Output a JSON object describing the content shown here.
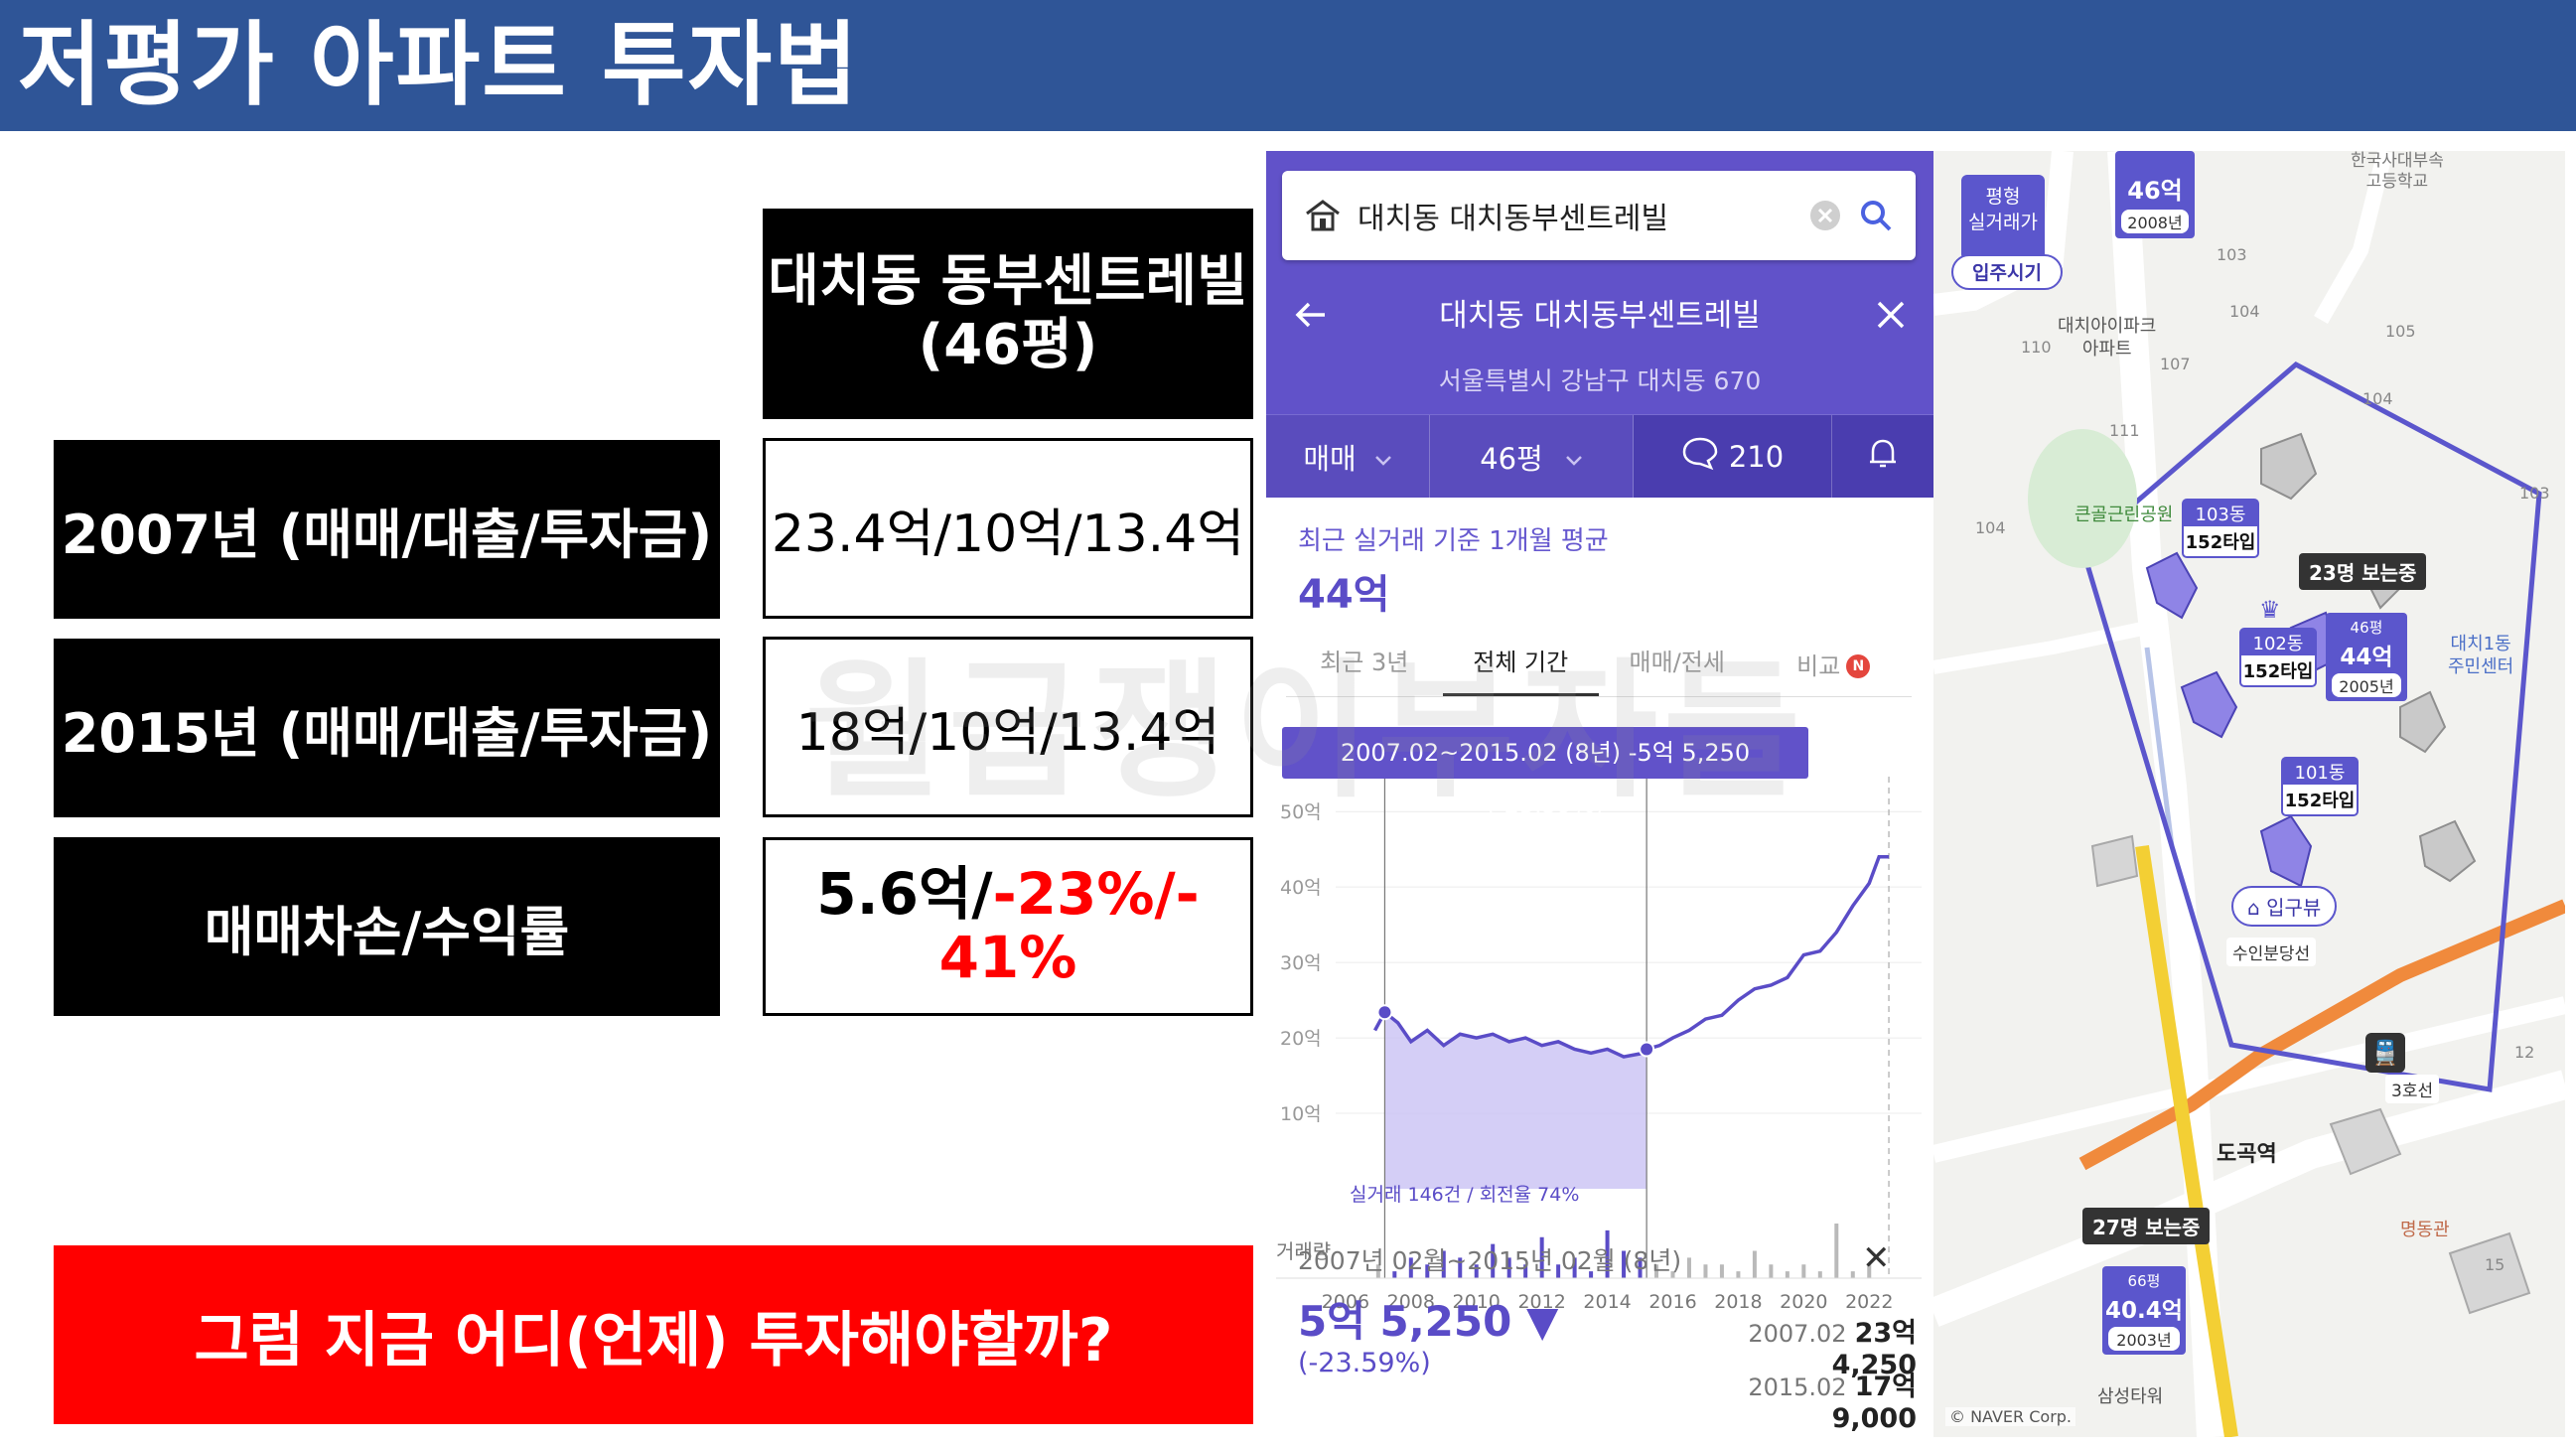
{
  "slide": {
    "title": "저평가 아파트 투자법",
    "table": {
      "apartment_header_line1": "대치동 동부센트레빌",
      "apartment_header_line2": "(46평)",
      "rows": [
        {
          "label": "2007년 (매매/대출/투자금)",
          "value": "23.4억/10억/13.4억"
        },
        {
          "label": "2015년 (매매/대출/투자금)",
          "value": "18억/10억/13.4억"
        },
        {
          "label": "매매차손/수익률",
          "value_prefix": "5.6억/",
          "value_red_1": "-23%/-",
          "value_red_2": "41%"
        }
      ]
    },
    "question": "그럼 지금 어디(언제) 투자해야할까?",
    "watermark": "월급쟁이부자들"
  },
  "app": {
    "search_query": "대치동 대치동부센트레빌",
    "nav_title": "대치동 대치동부센트레빌",
    "address": "서울특별시 강남구 대치동 670",
    "filters": {
      "trade_type": "매매",
      "size": "46평",
      "comment_count": "210"
    },
    "avg_caption": "최근 실거래 기준 1개월 평균",
    "avg_value": "44억",
    "tabs": [
      "최근 3년",
      "전체 기간",
      "매매/전세",
      "비교"
    ],
    "active_tab": "전체 기간",
    "compare_badge": "N",
    "tooltip": "2007.02~2015.02 (8년) -5억 5,250 (-23.59%)",
    "selection": {
      "range_label": "2007년 02월~2015년 02월 (8년)",
      "delta": "5억 5,250 ▼",
      "delta_percent": "(-23.59%)",
      "points": [
        {
          "date": "2007.02",
          "price": "23억 4,250"
        },
        {
          "date": "2015.02",
          "price": "17억 9,000"
        }
      ]
    },
    "accent_color": "#6152c9"
  },
  "chart_data": {
    "type": "line",
    "title": "",
    "xlabel": "",
    "ylabel": "",
    "y_tick_labels": [
      "50억",
      "40억",
      "30억",
      "20억",
      "10억"
    ],
    "y_ticks": [
      50,
      40,
      30,
      20,
      10
    ],
    "ylim": [
      0,
      52
    ],
    "x_tick_labels": [
      "2006",
      "2008",
      "2010",
      "2012",
      "2014",
      "2016",
      "2018",
      "2020",
      "2022"
    ],
    "x_ticks": [
      2006,
      2008,
      2010,
      2012,
      2014,
      2016,
      2018,
      2020,
      2022
    ],
    "xlim": [
      2005.7,
      2023.6
    ],
    "series": [
      {
        "x": [
          2006.9,
          2007.2,
          2007.6,
          2008.0,
          2008.5,
          2009.0,
          2009.5,
          2010.0,
          2010.5,
          2011.0,
          2011.5,
          2012.0,
          2012.5,
          2013.0,
          2013.5,
          2014.0,
          2014.5,
          2015.0,
          2015.2,
          2015.6,
          2016.0,
          2016.5,
          2017.0,
          2017.5,
          2018.0,
          2018.5,
          2019.0,
          2019.5,
          2020.0,
          2020.5,
          2021.0,
          2021.5,
          2022.0,
          2022.3,
          2022.6
        ],
        "y": [
          21,
          23.4,
          22,
          19.5,
          21,
          19,
          20.5,
          20,
          20.5,
          19.5,
          20,
          19,
          19.5,
          18.5,
          18,
          18.5,
          17.5,
          17.9,
          18.5,
          19,
          20,
          21,
          22.5,
          23,
          25,
          26.5,
          27,
          28,
          31,
          31.5,
          34,
          37.5,
          40.5,
          44,
          44
        ]
      }
    ],
    "highlight_range": [
      2007.2,
      2015.2
    ],
    "volume_label": "거래량",
    "volume_x": [
      2007,
      2007.5,
      2008,
      2008.5,
      2009,
      2009.5,
      2010,
      2010.5,
      2011,
      2011.5,
      2012,
      2012.5,
      2013,
      2013.5,
      2014,
      2014.5,
      2015,
      2015.5,
      2016,
      2016.5,
      2017,
      2017.5,
      2018,
      2018.5,
      2019,
      2019.5,
      2020,
      2020.5,
      2021,
      2021.5,
      2022
    ],
    "volume": [
      2,
      1,
      3,
      2,
      4,
      3,
      2,
      5,
      3,
      2,
      6,
      2,
      3,
      1,
      7,
      4,
      3,
      2,
      1,
      3,
      2,
      2,
      1,
      4,
      2,
      1,
      2,
      1,
      8,
      1,
      2
    ],
    "transactions_note": "실거래 146건 / 회전율 74%"
  },
  "map": {
    "labels": [
      {
        "text": "평형",
        "kind": "pill-top"
      },
      {
        "text": "실거래가",
        "kind": "pill-top"
      },
      {
        "text": "입주시기",
        "kind": "pill"
      },
      {
        "text": "대치아이파크",
        "kind": "place"
      },
      {
        "text": "아파트",
        "kind": "place"
      },
      {
        "text": "한국사대부속",
        "kind": "place"
      },
      {
        "text": "고등학교",
        "kind": "place"
      },
      {
        "text": "큰골근린공원",
        "kind": "place-green"
      },
      {
        "text": "23명 보는중",
        "kind": "dark"
      },
      {
        "text": "27명 보는중",
        "kind": "dark"
      },
      {
        "text": "입구뷰",
        "kind": "pill-blue"
      },
      {
        "text": "수인분당선",
        "kind": "small"
      },
      {
        "text": "3호선",
        "kind": "small"
      },
      {
        "text": "도곡역",
        "kind": "station"
      },
      {
        "text": "명동관",
        "kind": "place"
      },
      {
        "text": "삼성타워",
        "kind": "place"
      },
      {
        "text": "대치1동",
        "kind": "place-blue"
      },
      {
        "text": "주민센터",
        "kind": "place-blue"
      },
      {
        "text": "© NAVER Corp.",
        "kind": "credit"
      }
    ],
    "price_marker_top": {
      "size": "46억",
      "year": "2008년"
    },
    "building_tags": [
      {
        "dong": "103동",
        "type": "152타입"
      },
      {
        "dong": "102동",
        "type": "152타입"
      },
      {
        "dong": "101동",
        "type": "152타입"
      }
    ],
    "price_marker_target": {
      "size_label": "46평",
      "price": "44억",
      "year": "2005년"
    },
    "price_marker_bottom": {
      "size_label": "66평",
      "price": "40.4억",
      "year": "2003년"
    },
    "street_numbers": [
      "103",
      "104",
      "105",
      "110",
      "107",
      "104",
      "111",
      "104",
      "103",
      "12",
      "15"
    ]
  }
}
